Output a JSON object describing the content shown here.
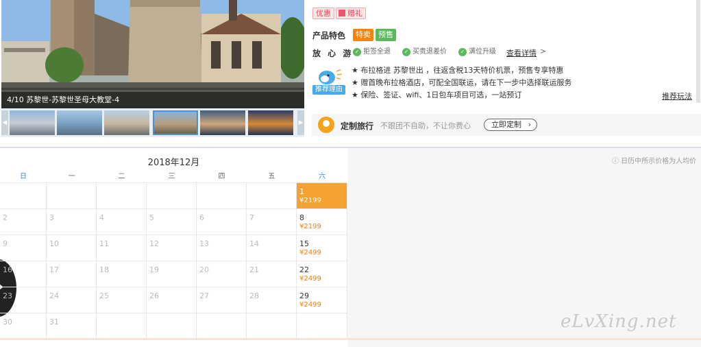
{
  "gallery": {
    "caption": "4/10 苏黎世-苏黎世圣母大教堂-4",
    "thumbnails": [
      "thumb-1",
      "thumb-2",
      "thumb-3",
      "thumb-4",
      "thumb-5",
      "thumb-6"
    ],
    "active_index": 4
  },
  "tags": {
    "promo": "优惠",
    "gift": "赠礼"
  },
  "features": {
    "label": "产品特色",
    "badges": [
      "特卖",
      "预售"
    ]
  },
  "assurance": {
    "label": "放 心 游",
    "items": [
      "拒签全退",
      "买贵退差价",
      "满位升级"
    ],
    "details_link": "查看详情",
    "chevron": ">"
  },
  "recommend": {
    "badge": "推荐理由",
    "lines": [
      "★ 布拉格进 苏黎世出 ，往返含税13天特价机票，预售专享特惠",
      "★ 赠首晚布拉格酒店，可配全国联运，请在下一步中选择联运服务",
      "★ 保险、签证、wifi、1日包车项目可选，一站预订"
    ],
    "link": "推荐玩法"
  },
  "custom": {
    "title": "定制旅行",
    "desc": "不跟团不自助，不让你费心",
    "button": "立即定制",
    "chevron": "›"
  },
  "calendar": {
    "title": "2018年12月",
    "note": "ⓘ 日历中所示价格为人均价",
    "weekdays": [
      "日",
      "一",
      "二",
      "三",
      "四",
      "五",
      "六"
    ],
    "rows": [
      [
        null,
        null,
        null,
        null,
        null,
        null,
        {
          "day": "1",
          "price": "¥2199",
          "selected": true
        }
      ],
      [
        {
          "day": "2"
        },
        {
          "day": "3"
        },
        {
          "day": "4"
        },
        {
          "day": "5"
        },
        {
          "day": "6"
        },
        {
          "day": "7"
        },
        {
          "day": "8",
          "price": "¥2199"
        }
      ],
      [
        {
          "day": "9"
        },
        {
          "day": "10"
        },
        {
          "day": "11"
        },
        {
          "day": "12"
        },
        {
          "day": "13"
        },
        {
          "day": "14"
        },
        {
          "day": "15",
          "price": "¥2499"
        }
      ],
      [
        {
          "day": "16"
        },
        {
          "day": "17"
        },
        {
          "day": "18"
        },
        {
          "day": "19"
        },
        {
          "day": "20"
        },
        {
          "day": "21"
        },
        {
          "day": "22",
          "price": "¥2499"
        }
      ],
      [
        {
          "day": "23"
        },
        {
          "day": "24"
        },
        {
          "day": "25"
        },
        {
          "day": "26"
        },
        {
          "day": "27"
        },
        {
          "day": "28"
        },
        {
          "day": "29",
          "price": "¥2499"
        }
      ],
      [
        {
          "day": "30"
        },
        {
          "day": "31"
        },
        null,
        null,
        null,
        null,
        null
      ]
    ]
  },
  "watermark": "eLvXing.net",
  "colors": {
    "accent": "#f5a330",
    "price": "#f27c0a",
    "blue": "#2d8fdd",
    "green": "#5cb85c"
  }
}
